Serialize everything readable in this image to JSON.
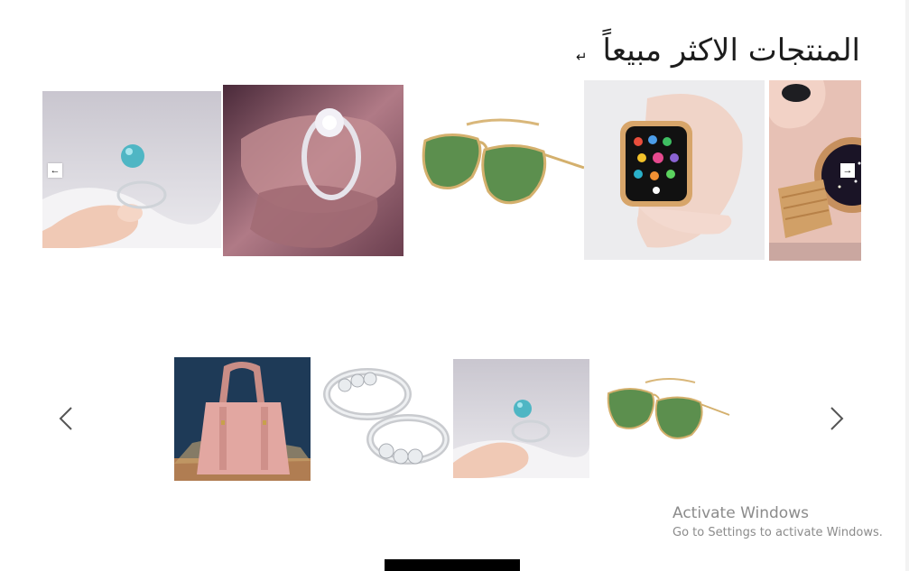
{
  "section": {
    "title": "المنتجات الاكثر مبيعاً"
  },
  "top_slider": {
    "prev_arrow": "←",
    "next_arrow": "→",
    "items": [
      {
        "icon": "ring-blue-stone-image"
      },
      {
        "icon": "diamond-ring-on-hand-image"
      },
      {
        "icon": "green-aviator-sunglasses-image"
      },
      {
        "icon": "smartwatch-pink-band-image"
      },
      {
        "icon": "starry-watch-gold-mesh-image"
      }
    ]
  },
  "bottom_slider": {
    "items": [
      {
        "icon": "pink-handbag-image"
      },
      {
        "icon": "silver-rings-pair-image"
      },
      {
        "icon": "ring-blue-stone-image"
      },
      {
        "icon": "green-aviator-sunglasses-image"
      }
    ]
  },
  "watermark": {
    "line1": "Activate Windows",
    "line2": "Go to Settings to activate Windows."
  }
}
